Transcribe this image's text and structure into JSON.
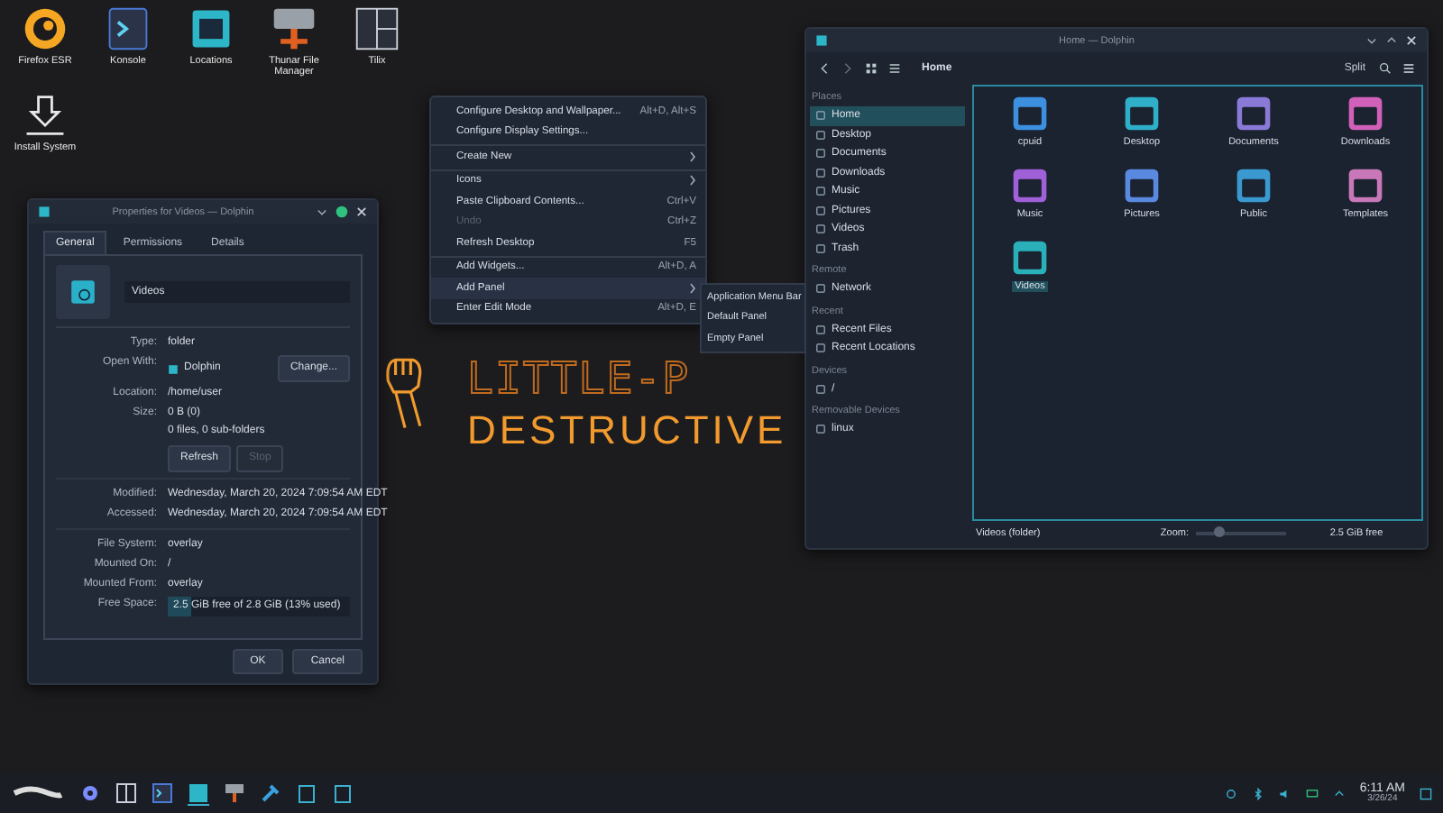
{
  "desktop_icons": [
    {
      "label": "Firefox ESR",
      "kind": "firefox"
    },
    {
      "label": "Konsole",
      "kind": "terminal"
    },
    {
      "label": "Locations",
      "kind": "folder"
    },
    {
      "label": "Thunar File Manager",
      "kind": "drive"
    },
    {
      "label": "Tilix",
      "kind": "tiles"
    },
    {
      "label": "Install System",
      "kind": "install"
    }
  ],
  "wallpaper": {
    "logo": "LITTLE-P",
    "tagline": "DESTRUCTIVE"
  },
  "properties_dialog": {
    "title": "Properties for Videos — Dolphin",
    "tabs": [
      {
        "label": "General",
        "selected": true
      },
      {
        "label": "Permissions",
        "selected": false
      },
      {
        "label": "Details",
        "selected": false
      }
    ],
    "name": "Videos",
    "sections": [
      {
        "rows": [
          {
            "kind": "text",
            "label": "Type:",
            "value": "folder"
          },
          {
            "kind": "app",
            "label": "Open With:",
            "value": "Dolphin",
            "button": "Change..."
          },
          {
            "kind": "text",
            "label": "Location:",
            "value": "/home/user"
          },
          {
            "kind": "size",
            "label": "Size:",
            "value": "0 B (0)",
            "detail": "0 files, 0 sub-folders",
            "buttons": [
              {
                "label": "Refresh",
                "disabled": false
              },
              {
                "label": "Stop",
                "disabled": true
              }
            ]
          }
        ]
      },
      {
        "rows": [
          {
            "kind": "text",
            "label": "Modified:",
            "value": "Wednesday, March 20, 2024 7:09:54 AM EDT"
          },
          {
            "kind": "text",
            "label": "Accessed:",
            "value": "Wednesday, March 20, 2024 7:09:54 AM EDT"
          }
        ]
      },
      {
        "rows": [
          {
            "kind": "text",
            "label": "File System:",
            "value": "overlay"
          },
          {
            "kind": "text",
            "label": "Mounted On:",
            "value": "/"
          },
          {
            "kind": "text",
            "label": "Mounted From:",
            "value": "overlay"
          },
          {
            "kind": "meter",
            "label": "Free Space:",
            "value": "2.5 GiB free of 2.8 GiB (13% used)",
            "level": 0.13
          }
        ]
      }
    ],
    "buttons": [
      "OK",
      "Cancel"
    ]
  },
  "context_menu": {
    "items": [
      {
        "label": "Configure Desktop and Wallpaper...",
        "shortcut": "Alt+D, Alt+S",
        "submenu": false,
        "disabled": false,
        "separator_before": false,
        "selected": false
      },
      {
        "label": "Configure Display Settings...",
        "submenu": false,
        "disabled": false,
        "separator_before": false,
        "selected": false
      },
      {
        "label": "Create New",
        "submenu": true,
        "disabled": false,
        "separator_before": true,
        "selected": false
      },
      {
        "label": "Icons",
        "submenu": true,
        "disabled": false,
        "separator_before": true,
        "selected": false
      },
      {
        "label": "Paste Clipboard Contents...",
        "shortcut": "Ctrl+V",
        "submenu": false,
        "disabled": false,
        "separator_before": false,
        "selected": false
      },
      {
        "label": "Undo",
        "shortcut": "Ctrl+Z",
        "submenu": false,
        "disabled": true,
        "separator_before": false,
        "selected": false
      },
      {
        "label": "Refresh Desktop",
        "shortcut": "F5",
        "submenu": false,
        "disabled": false,
        "separator_before": false,
        "selected": false
      },
      {
        "label": "Add Widgets...",
        "shortcut": "Alt+D, A",
        "submenu": false,
        "disabled": false,
        "separator_before": true,
        "selected": false
      },
      {
        "label": "Add Panel",
        "submenu": true,
        "disabled": false,
        "separator_before": false,
        "selected": true
      },
      {
        "label": "Enter Edit Mode",
        "shortcut": "Alt+D, E",
        "submenu": false,
        "disabled": false,
        "separator_before": false,
        "selected": false
      }
    ],
    "submenu": [
      "Application Menu Bar",
      "Default Panel",
      "Empty Panel"
    ]
  },
  "dolphin": {
    "title": "Home — Dolphin",
    "breadcrumb": "Home",
    "split": "Split",
    "sidebar": [
      {
        "header": "Places",
        "items": [
          {
            "label": "Home",
            "selected": true
          },
          {
            "label": "Desktop",
            "selected": false
          },
          {
            "label": "Documents",
            "selected": false
          },
          {
            "label": "Downloads",
            "selected": false
          },
          {
            "label": "Music",
            "selected": false
          },
          {
            "label": "Pictures",
            "selected": false
          },
          {
            "label": "Videos",
            "selected": false
          },
          {
            "label": "Trash",
            "selected": false
          }
        ]
      },
      {
        "header": "Remote",
        "items": [
          {
            "label": "Network",
            "selected": false
          }
        ]
      },
      {
        "header": "Recent",
        "items": [
          {
            "label": "Recent Files",
            "selected": false
          },
          {
            "label": "Recent Locations",
            "selected": false
          }
        ]
      },
      {
        "header": "Devices",
        "items": [
          {
            "label": "/",
            "selected": false
          }
        ]
      },
      {
        "header": "Removable Devices",
        "items": [
          {
            "label": "linux",
            "selected": false
          }
        ]
      }
    ],
    "files": [
      {
        "name": "cpuid",
        "color": "#3d8fe0",
        "selected": false
      },
      {
        "name": "Desktop",
        "color": "#2fb0c8",
        "selected": false
      },
      {
        "name": "Documents",
        "color": "#8a7ad8",
        "selected": false
      },
      {
        "name": "Downloads",
        "color": "#d060b8",
        "selected": false
      },
      {
        "name": "Music",
        "color": "#a060d8",
        "selected": false
      },
      {
        "name": "Pictures",
        "color": "#5a8ae0",
        "selected": false
      },
      {
        "name": "Public",
        "color": "#3a9ad0",
        "selected": false
      },
      {
        "name": "Templates",
        "color": "#c878b8",
        "selected": false
      },
      {
        "name": "Videos",
        "color": "#2ab0b8",
        "selected": true
      }
    ],
    "status": "Videos (folder)",
    "zoom_label": "Zoom:",
    "zoom": {
      "level": 0.25
    },
    "free": "2.5 GiB free"
  },
  "taskbar": {
    "time": "6:11 AM",
    "date": "3/26/24"
  }
}
